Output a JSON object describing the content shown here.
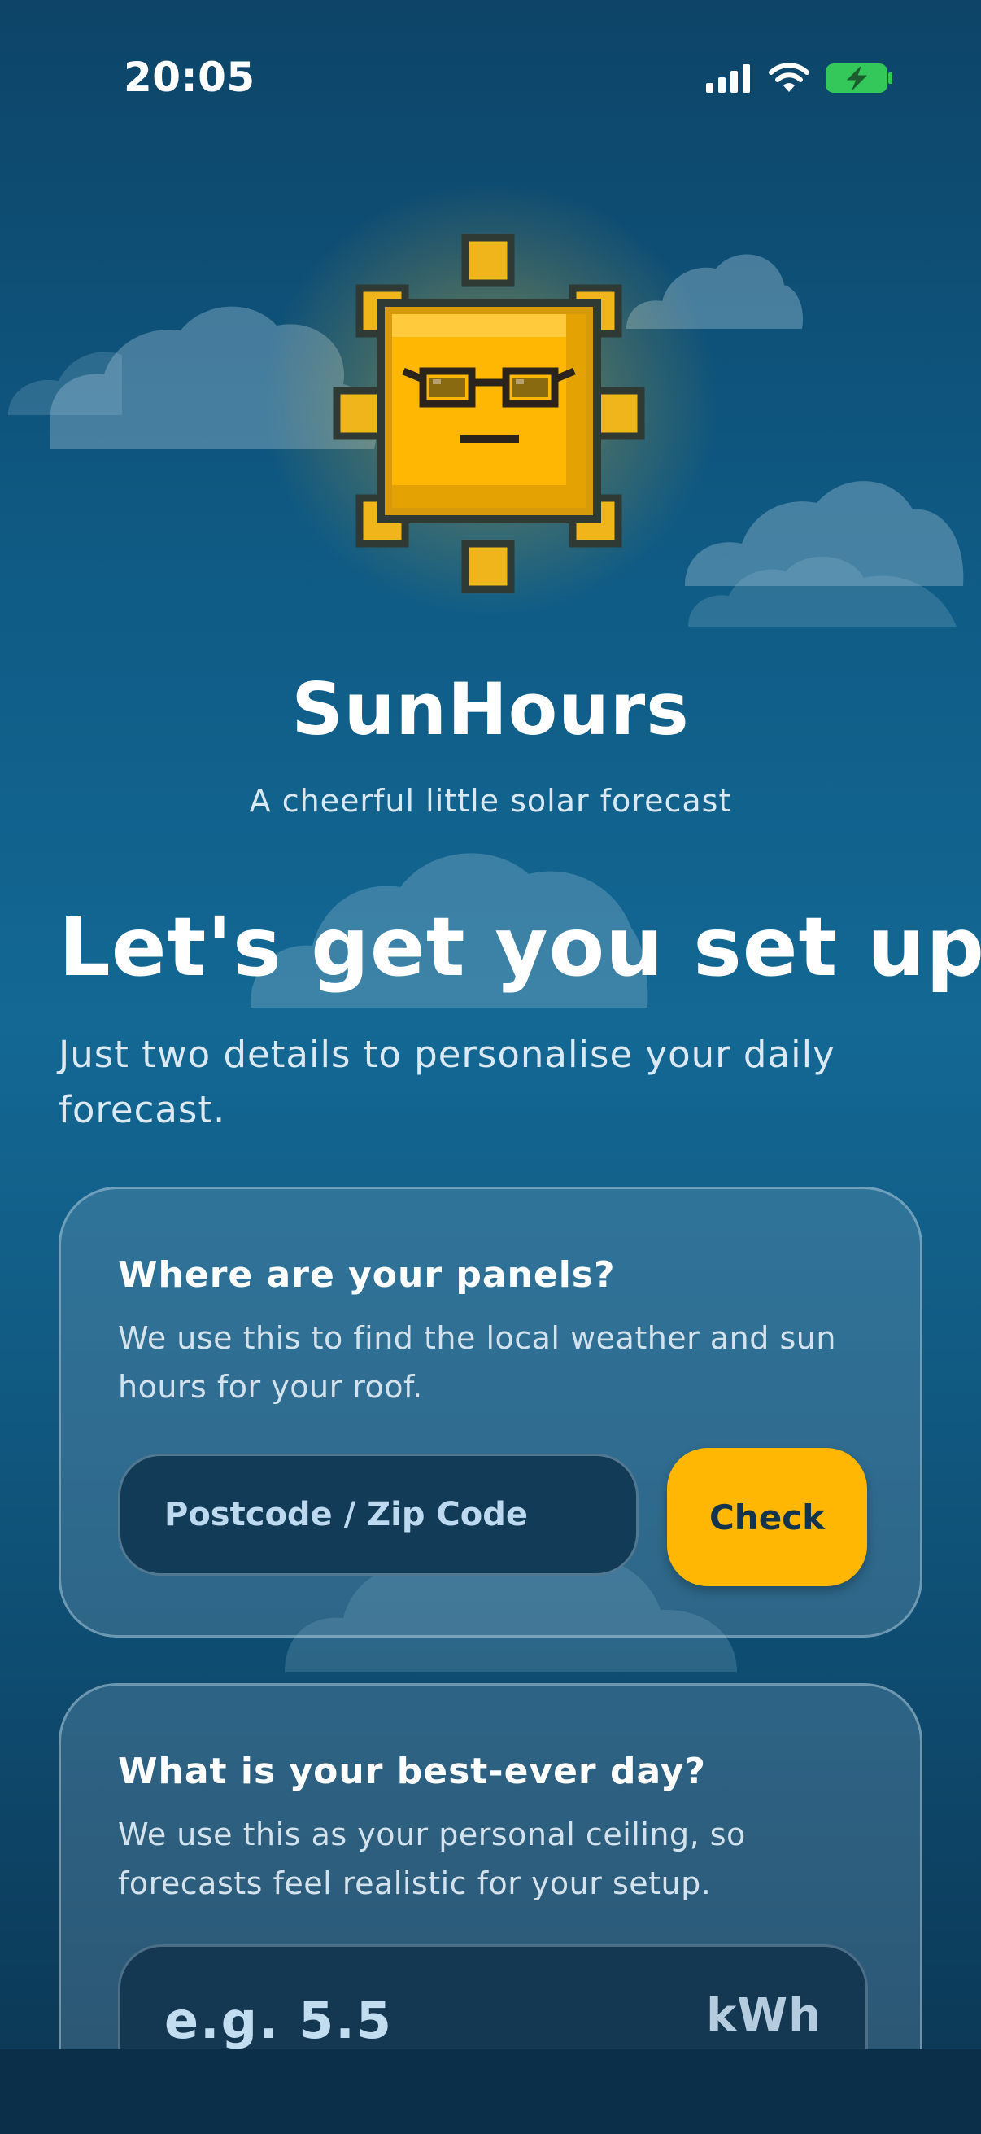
{
  "status_bar": {
    "time": "20:05",
    "icons": [
      "signal-icon",
      "wifi-icon",
      "battery-charging-icon"
    ]
  },
  "app": {
    "title": "SunHours",
    "tagline": "A cheerful little solar forecast"
  },
  "onboarding": {
    "headline": "Let's get you set up",
    "intro": "Just two details to personalise your daily forecast."
  },
  "location_card": {
    "title": "Where are your panels?",
    "description": "We use this to find the local weather and sun hours for your roof.",
    "input_placeholder": "Postcode / Zip Code",
    "input_value": "",
    "button_label": "Check"
  },
  "best_day_card": {
    "title": "What is your best-ever day?",
    "description": "We use this as your personal ceiling, so forecasts feel realistic for your setup.",
    "input_placeholder": "e.g. 5.5",
    "input_value": "",
    "unit": "kWh"
  },
  "colors": {
    "accent": "#ffb703",
    "background_top": "#0d4468",
    "background_mid": "#136894",
    "card_text_dark": "#12344d",
    "battery": "#34c759"
  }
}
